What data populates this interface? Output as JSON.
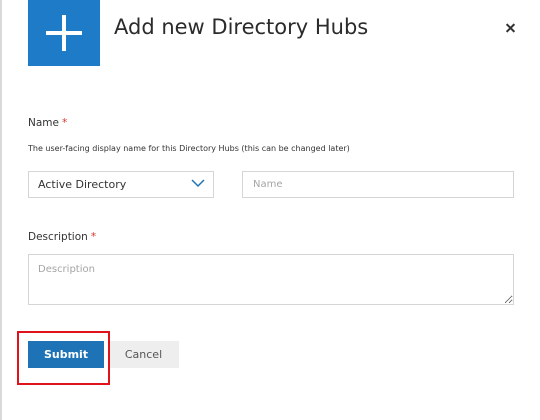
{
  "dialog": {
    "title": "Add new Directory Hubs",
    "header_icon": "plus-icon",
    "close_icon": "close-icon"
  },
  "form": {
    "name": {
      "label": "Name",
      "required_marker": "*",
      "help_text": "The user-facing display name for this Directory Hubs (this can be changed later)",
      "type_select_value": "Active Directory",
      "type_select_icon": "chevron-down-icon",
      "input_value": "",
      "input_placeholder": "Name"
    },
    "description": {
      "label": "Description",
      "required_marker": "*",
      "input_value": "",
      "input_placeholder": "Description"
    }
  },
  "actions": {
    "submit_label": "Submit",
    "cancel_label": "Cancel",
    "highlighted": "submit"
  },
  "colors": {
    "accent": "#1e7bc8",
    "primary_button": "#1e73b7",
    "required_marker": "#d9342b",
    "highlight_box": "#e0131b"
  }
}
